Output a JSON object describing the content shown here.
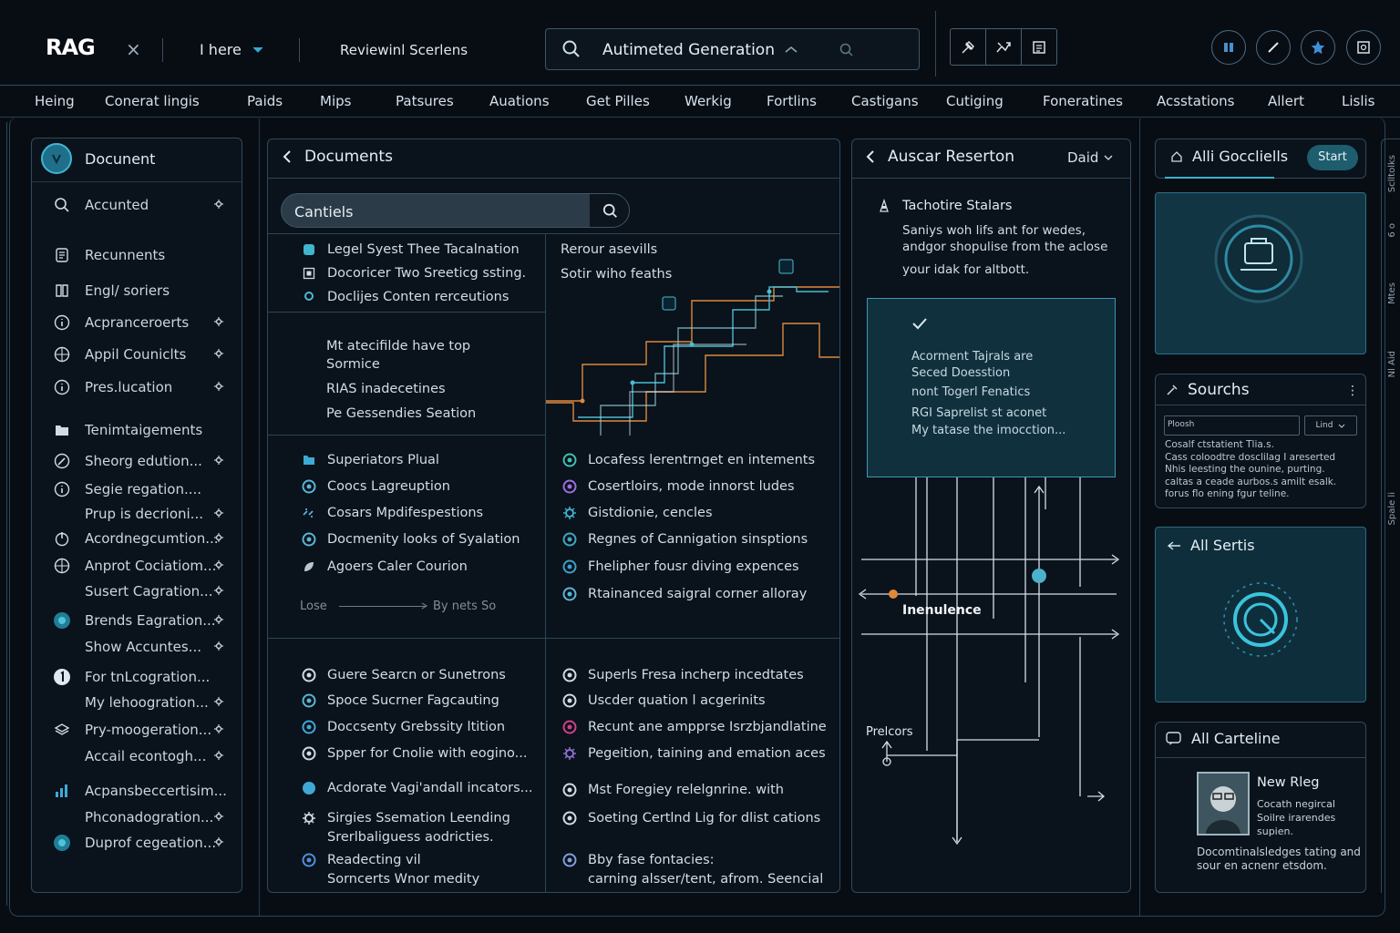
{
  "app": {
    "logo": "RAG"
  },
  "topbar": {
    "close_glyph": "×",
    "dropdown_label": "I here",
    "breadcrumb": "Reviewinl Scerlens",
    "search_value": "Autimeted Generation"
  },
  "nav": [
    "Heing",
    "Conerat lingis",
    "Paids",
    "Mips",
    "Patsures",
    "Auations",
    "Get Pilles",
    "Werkig",
    "Fortlins",
    "Castigans",
    "Cutiging",
    "Foneratines",
    "Acsstations",
    "Allert",
    "Lislis"
  ],
  "sidebar": {
    "header": "Docunent",
    "items": [
      {
        "label": "Accunted",
        "icon": "search-icon",
        "dot": true
      },
      {
        "label": "Recunnents",
        "icon": "document-icon",
        "dot": false
      },
      {
        "label": "Engl/ soriers",
        "icon": "book-icon",
        "dot": false
      },
      {
        "label": "Acpranceroerts",
        "icon": "info-icon",
        "dot": true
      },
      {
        "label": "Appil Couniclts",
        "icon": "globe-icon",
        "dot": true
      },
      {
        "label": "Pres.lucation",
        "icon": "info-icon",
        "dot": true
      },
      {
        "label": "Tenimtaigements",
        "icon": "folder-icon",
        "dot": false
      },
      {
        "label": "Sheorg edution...",
        "icon": "compass-icon",
        "dot": true
      },
      {
        "label": "Segie regation....",
        "icon": "info-icon",
        "dot": false
      },
      {
        "label": "Prup is decrioni...",
        "icon": "",
        "dot": true
      },
      {
        "label": "Acordnegcumtion...",
        "icon": "power-icon",
        "dot": true
      },
      {
        "label": "Anprot Cociatiom...",
        "icon": "globe-icon",
        "dot": true
      },
      {
        "label": "Susert Cagration...",
        "icon": "",
        "dot": true
      },
      {
        "label": "Brends Eagration...",
        "icon": "circle-icon",
        "dot": true
      },
      {
        "label": "Show Accuntes...",
        "icon": "",
        "dot": true
      },
      {
        "label": "For tnLcogration...",
        "icon": "number-icon",
        "dot": false
      },
      {
        "label": "My lehoogration...",
        "icon": "",
        "dot": true
      },
      {
        "label": "Pry-moogeration...",
        "icon": "stack-icon",
        "dot": true
      },
      {
        "label": "Accail econtogh...",
        "icon": "",
        "dot": true
      },
      {
        "label": "Acpansbeccertisim...",
        "icon": "chart-icon",
        "dot": false
      },
      {
        "label": "Phconadogration...",
        "icon": "",
        "dot": true
      },
      {
        "label": "Duprof cegeation...",
        "icon": "circle-icon",
        "dot": true
      }
    ]
  },
  "documents": {
    "title": "Documents",
    "search_value": "Cantiels",
    "list_a": [
      "Legel Syest Thee Tacalnation",
      "Docoricer Two Sreeticg ssting.",
      "Doclijes Conten rerceutions"
    ],
    "text_b1": "Mt atecifilde have top",
    "text_b2": "Sormice",
    "text_b3": "RIAS inadecetines",
    "text_b4": "Pe Gessendies Seation",
    "graph_label_1": "Rerour asevills",
    "graph_label_2": "Sotir wiho feaths",
    "list_c": [
      "Superiators Plual",
      "Coocs Lagreuption",
      "Cosars Mpdifespestions",
      "Docmenity looks of Syalation",
      "Agoers Caler Courion"
    ],
    "range_left": "Lose",
    "range_right": "By nets So",
    "list_d": [
      "Locafess lerentrnget en intements",
      "Cosertloirs, mode innorst ludes",
      "Gistdionie, cencles",
      "Regnes of Cannigation sinsptions",
      "Fhelipher fousr diving expences",
      "Rtainanced saigral corner alloray"
    ],
    "list_e": [
      "Guere Searcn or Sunetrons",
      "Spoce Sucrner Fagcauting",
      "Doccsenty Grebssity ltition",
      "Spper for Cnolie with eogino...",
      "Acdorate Vagi'andall incators...",
      "Sirgies Ssemation Leending",
      "Srerlbaliguess aodricties.",
      "Readecting vil",
      "Sorncerts Wnor medity"
    ],
    "list_f": [
      "Superls Fresa incherp incedtates",
      "Uscder quation l acgerinits",
      "Recunt ane ampprse Isrzbjandlatine",
      "Pegeition, taining and emation aces",
      "Mst Foregiey relelgnrine. with",
      "Soeting Certlnd Lig for dlist cations",
      "Bby fase fontacies:",
      "carning alsser/tent, afrom. Seencial"
    ]
  },
  "research": {
    "title": "Auscar Reserton",
    "dropdown": "Daid",
    "heading": "Tachotire Stalars",
    "para": [
      "Saniys woh lifs ant for wedes,",
      "andgor shopulise from the aclose",
      "your idak for altbott."
    ],
    "card_lines": [
      "Acorment Tajrals are",
      "Seced Doesstion",
      "nont Togerl Fenatics",
      "RGI Saprelist st aconet",
      "My tatase the imocction..."
    ],
    "flow_label": "Inenulence",
    "flow_label_2": "Prelcors"
  },
  "right": {
    "all_goals": "Alli Goccliells",
    "start": "Start",
    "sources_title": "Sourchs",
    "source_input": "Ploosh",
    "source_select": "Lind",
    "source_text": [
      "Cosalf ctstatient    Tlia.s.",
      "Cass coloodtre dosclilag I areserted",
      "Nhis leesting the ounine, purting.",
      "caltas a ceade aurbos.s amilt esalk.",
      "forus flo ening fgur teline."
    ],
    "all_sertis": "All Sertis",
    "all_carteline": "All Carteline",
    "profile_name": "New Rleg",
    "profile_text": [
      "Cocath negircal",
      "Soilre irarendes",
      "supien."
    ],
    "profile_desc": [
      "Docomtinalsledges tating and",
      "sour en acnenr etsdom."
    ]
  },
  "edge_text": [
    "Sclltolks",
    "6 o",
    "Mtes",
    "Nl Aid",
    "Spale  li"
  ],
  "colors": {
    "accent": "#2ca7bd",
    "panel_border": "#2f4a5c",
    "orange": "#e0883a",
    "teal": "#4bbcd0"
  }
}
